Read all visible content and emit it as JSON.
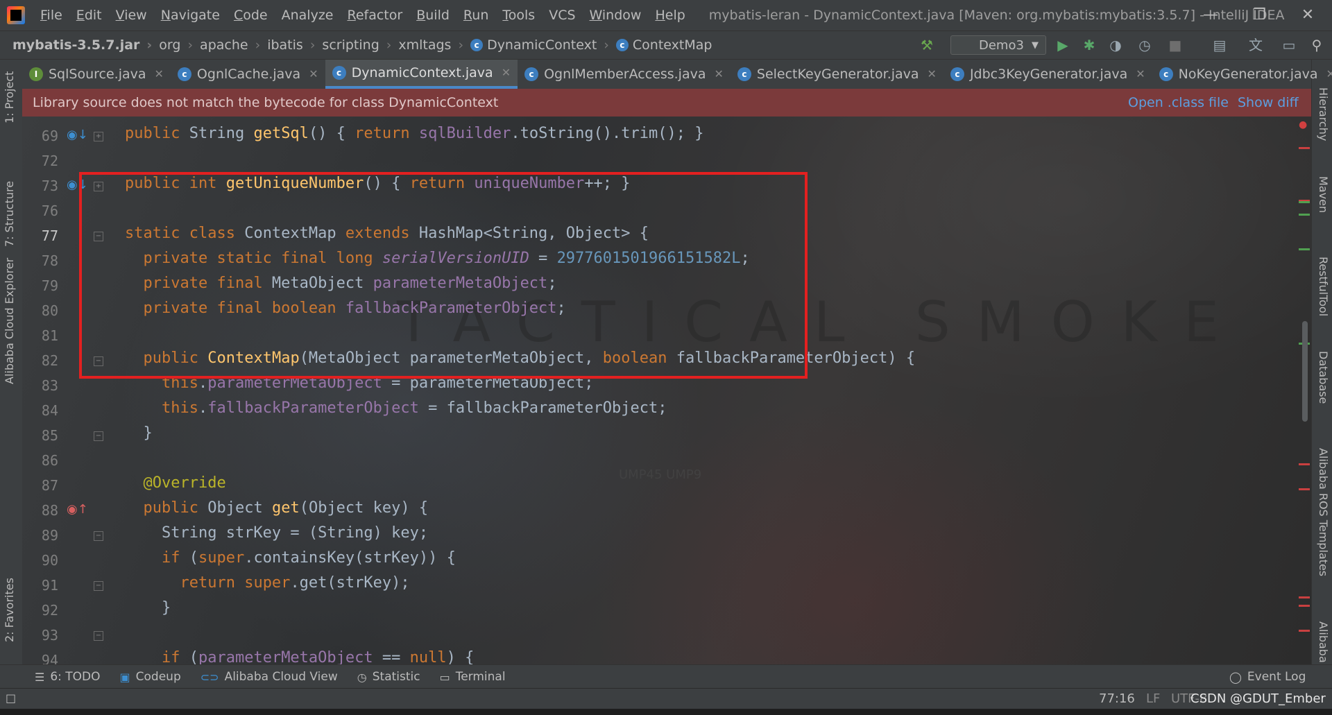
{
  "titlebar": {
    "menu": [
      "File",
      "Edit",
      "View",
      "Navigate",
      "Code",
      "Analyze",
      "Refactor",
      "Build",
      "Run",
      "Tools",
      "VCS",
      "Window",
      "Help"
    ],
    "window_title": "mybatis-leran - DynamicContext.java [Maven: org.mybatis:mybatis:3.5.7] - IntelliJ IDEA"
  },
  "navbar": {
    "crumbs": [
      "mybatis-3.5.7.jar",
      "org",
      "apache",
      "ibatis",
      "scripting",
      "xmltags",
      "DynamicContext",
      "ContextMap"
    ],
    "run_config": "Demo3"
  },
  "tabs": [
    {
      "label": "SqlSource.java",
      "icon": "interface-icon"
    },
    {
      "label": "OgnlCache.java",
      "icon": "class-icon"
    },
    {
      "label": "DynamicContext.java",
      "icon": "class-icon",
      "active": true
    },
    {
      "label": "OgnlMemberAccess.java",
      "icon": "class-icon"
    },
    {
      "label": "SelectKeyGenerator.java",
      "icon": "class-icon"
    },
    {
      "label": "Jdbc3KeyGenerator.java",
      "icon": "class-icon"
    },
    {
      "label": "NoKeyGenerator.java",
      "icon": "class-icon"
    }
  ],
  "banner": {
    "message": "Library source does not match the bytecode for class DynamicContext",
    "open_class": "Open .class file",
    "show_diff": "Show diff"
  },
  "left_tools": [
    "1: Project",
    "7: Structure",
    "Alibaba Cloud Explorer",
    "2: Favorites"
  ],
  "right_tools": [
    "Hierarchy",
    "Maven",
    "RestfulTool",
    "Database",
    "Alibaba ROS Templates",
    "Alibaba"
  ],
  "line_numbers": [
    "69",
    "72",
    "73",
    "76",
    "77",
    "78",
    "79",
    "80",
    "81",
    "82",
    "83",
    "84",
    "85",
    "86",
    "87",
    "88",
    "89",
    "90",
    "91",
    "92",
    "93",
    "94"
  ],
  "watermark": "TACTICAL SMOKE",
  "watermark2": "UMP45  UMP9",
  "bottom_tools": [
    {
      "label": "6: TODO",
      "icon": "list-icon"
    },
    {
      "label": "Codeup",
      "icon": "codeup-icon"
    },
    {
      "label": "Alibaba Cloud View",
      "icon": "cloud-icon"
    },
    {
      "label": "Statistic",
      "icon": "statistic-icon"
    },
    {
      "label": "Terminal",
      "icon": "terminal-icon"
    }
  ],
  "event_log": "Event Log",
  "status": {
    "position": "77:16",
    "line_sep": "LF",
    "encoding": "UTF-8",
    "watermark_text": "CSDN @GDUT_Ember"
  },
  "colors": {
    "keyword": "#cc7832",
    "function": "#ffc66d",
    "field": "#9876aa",
    "number": "#6897bb",
    "annotation": "#bbb529",
    "highlight_box": "#e32020",
    "banner_bg": "#7b3a3b"
  }
}
